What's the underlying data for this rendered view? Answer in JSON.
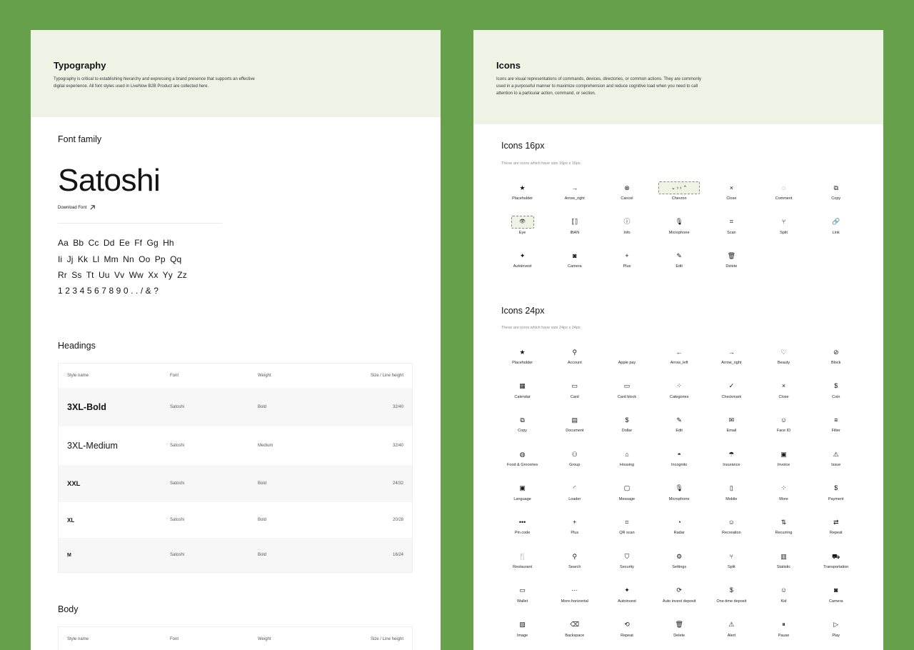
{
  "typography": {
    "title": "Typography",
    "description": "Typography is critical to establishing hierarchy and expressing a brand presence that supports an effective digital experience. All font styles used in LiveNow B2B Product are collected here.",
    "font_family_title": "Font family",
    "font_name": "Satoshi",
    "download_label": "Download Font",
    "alphabet_rows": [
      "Aa Bb Cc Dd Ee Ff Gg Hh",
      "Ii Jj Kk Ll Mm Nn Oo Pp Qq",
      "Rr Ss Tt Uu Vv Ww Xx Yy Zz",
      "1 2 3 4 5 6 7 8 9 0 . . / & ?"
    ],
    "headings_title": "Headings",
    "body_title": "Body",
    "columns": [
      "Style name",
      "Font",
      "Weight",
      "Size / Line height"
    ],
    "headings": [
      {
        "name": "3XL-Bold",
        "font": "Satoshi",
        "weight": "Bold",
        "size": "32/40"
      },
      {
        "name": "3XL-Medium",
        "font": "Satoshi",
        "weight": "Medium",
        "size": "32/40"
      },
      {
        "name": "XXL",
        "font": "Satoshi",
        "weight": "Bold",
        "size": "24/32"
      },
      {
        "name": "XL",
        "font": "Satoshi",
        "weight": "Bold",
        "size": "20/28"
      },
      {
        "name": "M",
        "font": "Satoshi",
        "weight": "Bold",
        "size": "16/24"
      }
    ]
  },
  "icons": {
    "title": "Icons",
    "description": "Icons are visual representations of commands, devices, directories, or common actions. They are commonly used in a purposeful manner to maximize comprehension and reduce cognitive load when you need to call attention to a particular action, command, or section.",
    "icons16_title": "Icons 16px",
    "icons16_sub": "These are icons which have size 16px x 16px.",
    "icons24_title": "Icons 24px",
    "icons24_sub": "These are icons which have size 24px x 24px.",
    "icons16": [
      {
        "label": "Placeholder",
        "glyph": "★",
        "icon": "star-icon"
      },
      {
        "label": "Arrow_right",
        "glyph": "→",
        "icon": "arrow-right-icon"
      },
      {
        "label": "Cancel",
        "glyph": "⊗",
        "icon": "cancel-icon"
      },
      {
        "label": "Chevron",
        "glyph": "⌄  ›  ‹  ⌃",
        "icon": "chevron-icon"
      },
      {
        "label": "Close",
        "glyph": "×",
        "icon": "close-icon"
      },
      {
        "label": "Comment",
        "glyph": "◌",
        "icon": "comment-icon"
      },
      {
        "label": "Copy",
        "glyph": "⧉",
        "icon": "copy-icon"
      },
      {
        "label": "Eye",
        "glyph": "👁",
        "icon": "eye-icon"
      },
      {
        "label": "IBAN",
        "glyph": "⟦⟧",
        "icon": "iban-icon"
      },
      {
        "label": "Info",
        "glyph": "ⓘ",
        "icon": "info-icon"
      },
      {
        "label": "Microphone",
        "glyph": "🎙",
        "icon": "microphone-icon"
      },
      {
        "label": "Scan",
        "glyph": "⌗",
        "icon": "scan-icon"
      },
      {
        "label": "Split",
        "glyph": "⑂",
        "icon": "split-icon"
      },
      {
        "label": "Link",
        "glyph": "🔗",
        "icon": "link-icon"
      },
      {
        "label": "Autoinvest",
        "glyph": "✦",
        "icon": "autoinvest-icon"
      },
      {
        "label": "Camera",
        "glyph": "◙",
        "icon": "camera-icon"
      },
      {
        "label": "Plus",
        "glyph": "+",
        "icon": "plus-icon"
      },
      {
        "label": "Edit",
        "glyph": "✎",
        "icon": "edit-icon"
      },
      {
        "label": "Delete",
        "glyph": "🗑",
        "icon": "delete-icon"
      }
    ],
    "icons24": [
      {
        "label": "Placeholder",
        "glyph": "★",
        "icon": "star-icon"
      },
      {
        "label": "Account",
        "glyph": "⚲",
        "icon": "account-icon"
      },
      {
        "label": "Apple pay",
        "glyph": "",
        "icon": "apple-icon"
      },
      {
        "label": "Arrow_left",
        "glyph": "←",
        "icon": "arrow-left-icon"
      },
      {
        "label": "Arrow_right",
        "glyph": "→",
        "icon": "arrow-right-icon"
      },
      {
        "label": "Beauty",
        "glyph": "♡",
        "icon": "beauty-icon"
      },
      {
        "label": "Block",
        "glyph": "⊘",
        "icon": "block-icon"
      },
      {
        "label": "Calendar",
        "glyph": "▦",
        "icon": "calendar-icon"
      },
      {
        "label": "Card",
        "glyph": "▭",
        "icon": "card-icon"
      },
      {
        "label": "Card block",
        "glyph": "▭",
        "icon": "card-block-icon"
      },
      {
        "label": "Categories",
        "glyph": "⁘",
        "icon": "categories-icon"
      },
      {
        "label": "Checkmark",
        "glyph": "✓",
        "icon": "checkmark-icon"
      },
      {
        "label": "Close",
        "glyph": "×",
        "icon": "close-icon"
      },
      {
        "label": "Coin",
        "glyph": "$",
        "icon": "coin-icon"
      },
      {
        "label": "Copy",
        "glyph": "⧉",
        "icon": "copy-icon"
      },
      {
        "label": "Document",
        "glyph": "▤",
        "icon": "document-icon"
      },
      {
        "label": "Dollar",
        "glyph": "$",
        "icon": "dollar-icon"
      },
      {
        "label": "Edit",
        "glyph": "✎",
        "icon": "edit-icon"
      },
      {
        "label": "Email",
        "glyph": "✉",
        "icon": "email-icon"
      },
      {
        "label": "Face ID",
        "glyph": "☺",
        "icon": "face-id-icon"
      },
      {
        "label": "Filter",
        "glyph": "≡",
        "icon": "filter-icon"
      },
      {
        "label": "Food & Groceries",
        "glyph": "◍",
        "icon": "food-icon"
      },
      {
        "label": "Group",
        "glyph": "⚇",
        "icon": "group-icon"
      },
      {
        "label": "Housing",
        "glyph": "⌂",
        "icon": "housing-icon"
      },
      {
        "label": "Incognito",
        "glyph": "◓",
        "icon": "incognito-icon"
      },
      {
        "label": "Insurance",
        "glyph": "☂",
        "icon": "insurance-icon"
      },
      {
        "label": "Invoice",
        "glyph": "▣",
        "icon": "invoice-icon"
      },
      {
        "label": "Issue",
        "glyph": "⚠",
        "icon": "issue-icon"
      },
      {
        "label": "Language",
        "glyph": "▣",
        "icon": "language-icon"
      },
      {
        "label": "Loader",
        "glyph": "◜",
        "icon": "loader-icon"
      },
      {
        "label": "Message",
        "glyph": "▢",
        "icon": "message-icon"
      },
      {
        "label": "Microphone",
        "glyph": "🎙",
        "icon": "microphone-icon"
      },
      {
        "label": "Mobile",
        "glyph": "▯",
        "icon": "mobile-icon"
      },
      {
        "label": "More",
        "glyph": "⁘",
        "icon": "more-icon"
      },
      {
        "label": "Payment",
        "glyph": "$",
        "icon": "payment-icon"
      },
      {
        "label": "Pin code",
        "glyph": "•••",
        "icon": "pin-code-icon"
      },
      {
        "label": "Plus",
        "glyph": "+",
        "icon": "plus-icon"
      },
      {
        "label": "QR scan",
        "glyph": "⌗",
        "icon": "qr-scan-icon"
      },
      {
        "label": "Radar",
        "glyph": "◔",
        "icon": "radar-icon"
      },
      {
        "label": "Recreation",
        "glyph": "☺",
        "icon": "recreation-icon"
      },
      {
        "label": "Recurring",
        "glyph": "⇅",
        "icon": "recurring-icon"
      },
      {
        "label": "Repeat",
        "glyph": "⇄",
        "icon": "repeat-icon"
      },
      {
        "label": "Restaurant",
        "glyph": "🍴",
        "icon": "restaurant-icon"
      },
      {
        "label": "Search",
        "glyph": "⚲",
        "icon": "search-icon"
      },
      {
        "label": "Security",
        "glyph": "⛉",
        "icon": "security-icon"
      },
      {
        "label": "Settings",
        "glyph": "⚙",
        "icon": "settings-icon"
      },
      {
        "label": "Split",
        "glyph": "⑂",
        "icon": "split-icon"
      },
      {
        "label": "Statistic",
        "glyph": "▥",
        "icon": "statistic-icon"
      },
      {
        "label": "Transportation",
        "glyph": "⛟",
        "icon": "transportation-icon"
      },
      {
        "label": "Wallet",
        "glyph": "▭",
        "icon": "wallet-icon"
      },
      {
        "label": "More-horizontal",
        "glyph": "···",
        "icon": "more-horizontal-icon"
      },
      {
        "label": "Autoinvest",
        "glyph": "✦",
        "icon": "autoinvest-icon"
      },
      {
        "label": "Auto invest deposit",
        "glyph": "⟳",
        "icon": "auto-invest-deposit-icon"
      },
      {
        "label": "One-time deposit",
        "glyph": "$",
        "icon": "one-time-deposit-icon"
      },
      {
        "label": "Kid",
        "glyph": "☺",
        "icon": "kid-icon"
      },
      {
        "label": "Camera",
        "glyph": "◙",
        "icon": "camera-icon"
      },
      {
        "label": "Image",
        "glyph": "▨",
        "icon": "image-icon"
      },
      {
        "label": "Backspace",
        "glyph": "⌫",
        "icon": "backspace-icon"
      },
      {
        "label": "Repeat",
        "glyph": "⟲",
        "icon": "repeat-alt-icon"
      },
      {
        "label": "Delete",
        "glyph": "🗑",
        "icon": "delete-icon"
      },
      {
        "label": "Alert",
        "glyph": "⚠",
        "icon": "alert-icon"
      },
      {
        "label": "Pause",
        "glyph": "⏸",
        "icon": "pause-icon"
      },
      {
        "label": "Play",
        "glyph": "▷",
        "icon": "play-icon"
      }
    ]
  }
}
